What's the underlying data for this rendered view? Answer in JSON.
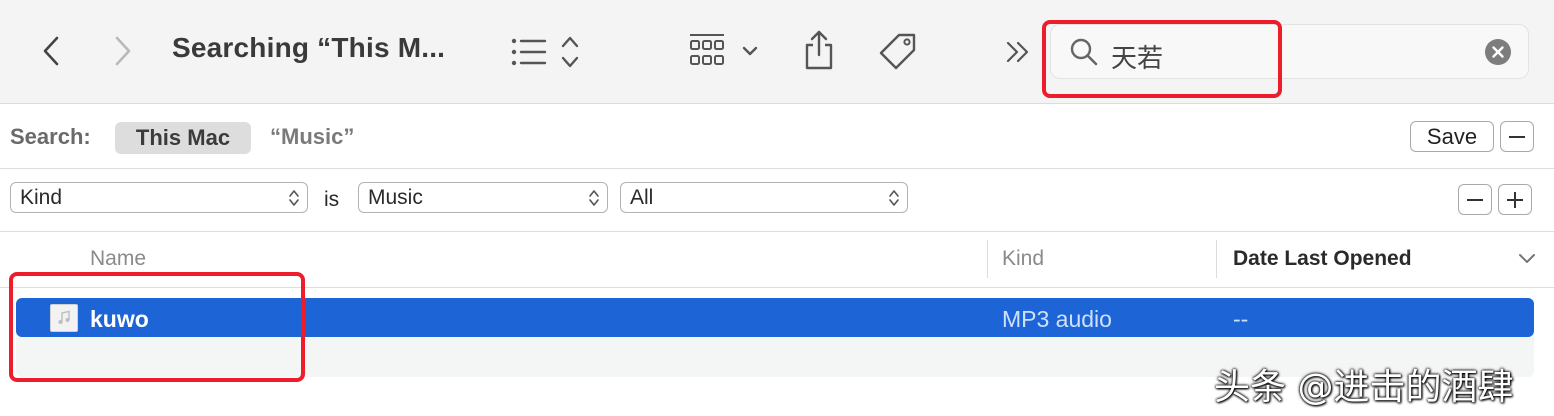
{
  "toolbar": {
    "title": "Searching “This M...",
    "back_icon": "chevron-left-icon",
    "forward_icon": "chevron-right-icon",
    "view_icon": "list-view-icon",
    "group_icon": "group-grid-icon",
    "share_icon": "share-icon",
    "tag_icon": "tag-icon",
    "more_icon": "double-chevron-right-icon"
  },
  "search": {
    "query": "天若",
    "search_icon": "magnifier-icon",
    "clear_icon": "clear-x-icon"
  },
  "scope": {
    "label": "Search:",
    "this_mac": "This Mac",
    "music": "“Music”",
    "save": "Save"
  },
  "criteria": {
    "attribute": "Kind",
    "operator": "is",
    "value": "Music",
    "sub_value": "All"
  },
  "columns": {
    "name": "Name",
    "kind": "Kind",
    "date": "Date Last Opened"
  },
  "results": [
    {
      "name": "kuwo",
      "kind": "MP3 audio",
      "date": "--",
      "icon": "music-file-icon"
    }
  ],
  "watermark": "头条 @进击的酒肆",
  "colors": {
    "selection": "#1d64d6",
    "annotation": "#ee1d2c"
  }
}
